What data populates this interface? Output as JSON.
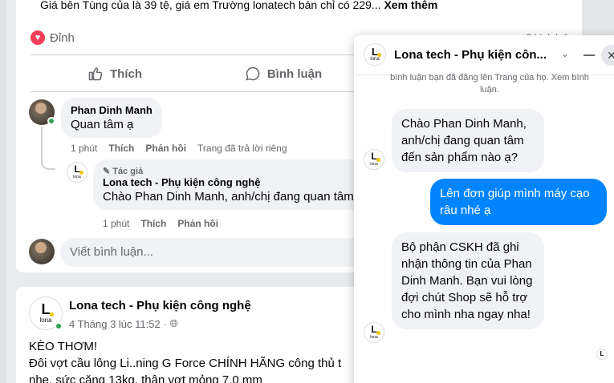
{
  "post1": {
    "top_text": "Giá bên Tùng của là 39 tệ, giá em Trường lonatech bán chỉ có 229...",
    "see_more": "Xem thêm",
    "reaction_label": "Đỉnh",
    "reaction_count": "3 bình luận",
    "actions": {
      "like": "Thích",
      "comment": "Bình luận"
    },
    "comment": {
      "author": "Phan Dinh Manh",
      "text": "Quan tâm ạ",
      "time": "1 phút",
      "like": "Thích",
      "reply": "Phản hồi",
      "status": "Trang đã trả lời riêng"
    },
    "reply": {
      "author_tag": "Tác giả",
      "author": "Lona tech - Phụ kiện công nghệ",
      "text": "Chào Phan Dinh Manh, anh/chị đang quan tâm",
      "time": "1 phút",
      "like": "Thích",
      "reply": "Phản hồi"
    },
    "write_placeholder": "Viết bình luận..."
  },
  "post2": {
    "page_name": "Lona tech - Phụ kiện công nghệ",
    "time": "4 Tháng 3 lúc 11:52 ·",
    "line1": "KÈO THƠM!",
    "line2": "Đôi vợt cầu lông Li..ning G Force CHÍNH HÃNG công thủ t",
    "line3": "nhẹ, sức căng 13kg, thân vợt mỏng 7,0 mm"
  },
  "chat": {
    "title": "Lona tech - Phụ kiện côn...",
    "system_note": "bình luận bạn đã đăng lên Trang của họ. Xem bình luận.",
    "messages": [
      {
        "from": "page",
        "text": "Chào Phan Dinh Manh, anh/chị đang quan tâm đến sản phẩm nào ạ?"
      },
      {
        "from": "user",
        "text": "Lên đơn giúp mình máy cạo râu nhé ạ"
      },
      {
        "from": "page",
        "text": "Bộ phận CSKH đã ghi nhận thông tin của Phan Dinh Manh. Bạn vui lòng đợi chút Shop sẽ hỗ trợ cho mình nha ngay nha!"
      }
    ]
  },
  "brand": {
    "logo_letter": "L",
    "logo_word": "lona"
  },
  "colors": {
    "accent": "#0084ff",
    "heart": "#f33e58",
    "online": "#31a24c",
    "logo_dot": "#f2c200"
  }
}
